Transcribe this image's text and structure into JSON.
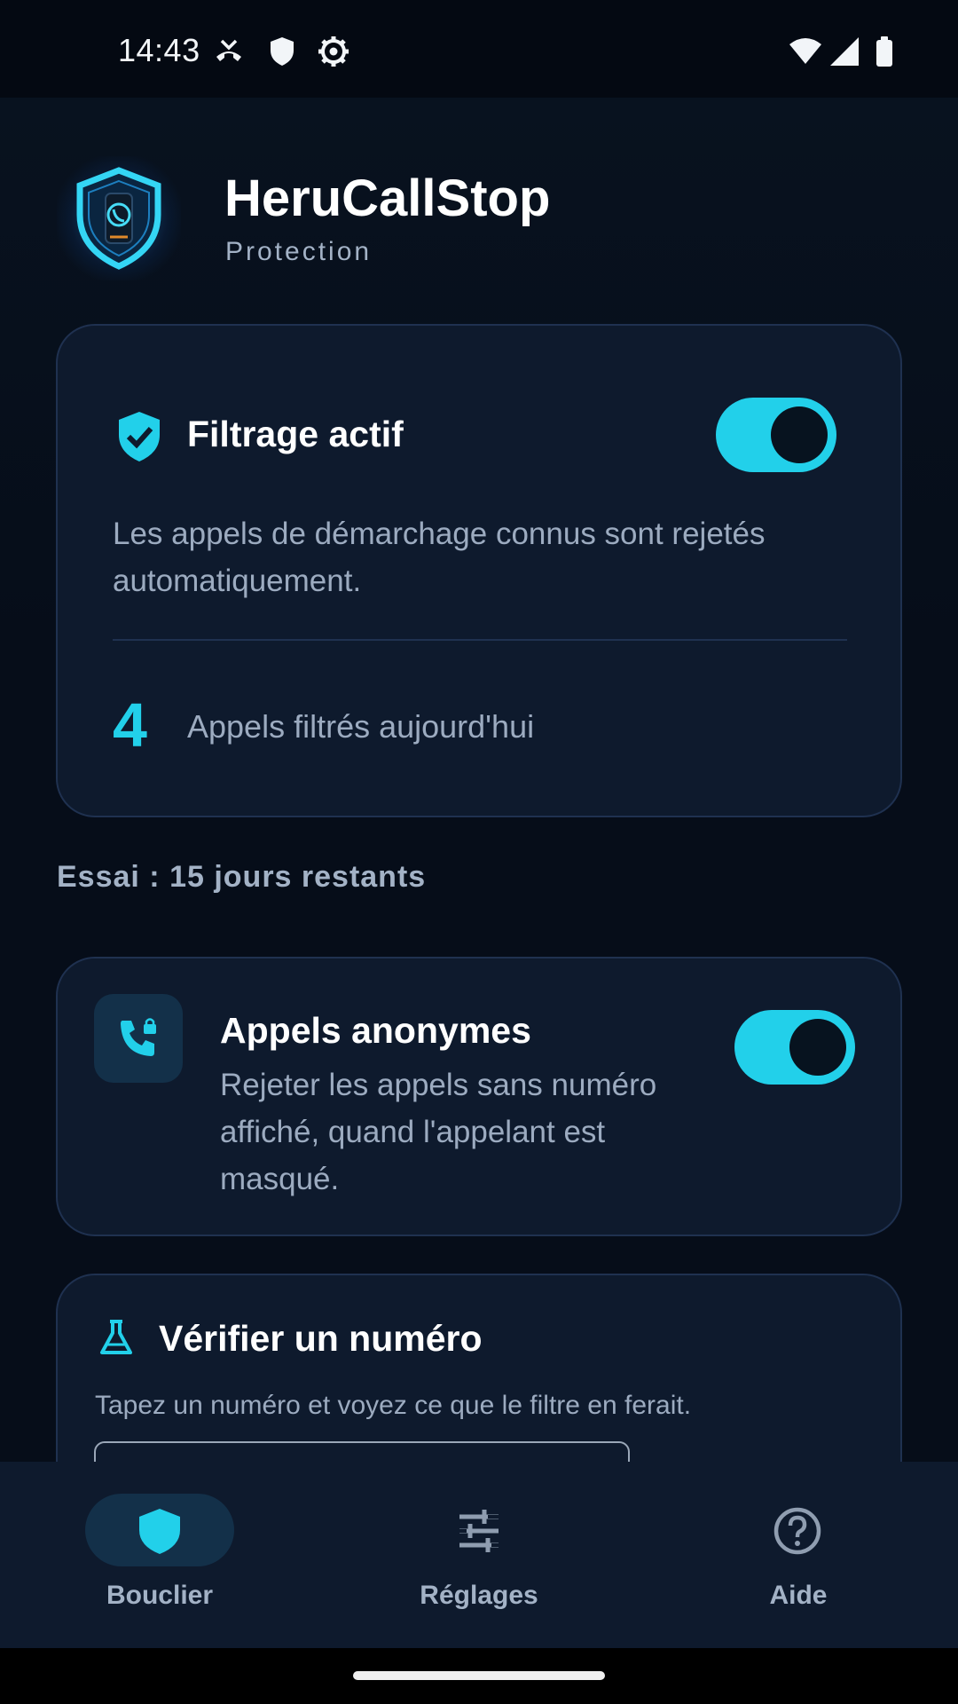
{
  "status_bar": {
    "time": "14:43"
  },
  "header": {
    "app_name": "HeruCallStop",
    "subtitle": "Protection"
  },
  "filter_card": {
    "title": "Filtrage actif",
    "enabled": true,
    "description": "Les appels de démarchage connus sont rejetés automatiquement.",
    "count": "4",
    "count_label": "Appels filtrés aujourd'hui"
  },
  "trial": {
    "text": "Essai : 15 jours restants"
  },
  "anonymous_card": {
    "title": "Appels anonymes",
    "enabled": true,
    "description": "Rejeter les appels sans numéro affiché, quand l'appelant est masqué."
  },
  "verify_card": {
    "title": "Vérifier un numéro",
    "description": "Tapez un numéro et voyez ce que le filtre en ferait."
  },
  "bottom_nav": {
    "items": [
      {
        "label": "Bouclier",
        "icon": "shield-icon",
        "active": true
      },
      {
        "label": "Réglages",
        "icon": "tune-icon",
        "active": false
      },
      {
        "label": "Aide",
        "icon": "help-icon",
        "active": false
      }
    ]
  },
  "colors": {
    "accent": "#22d0ea",
    "background": "#060d19",
    "card": "#0e1a2d"
  }
}
